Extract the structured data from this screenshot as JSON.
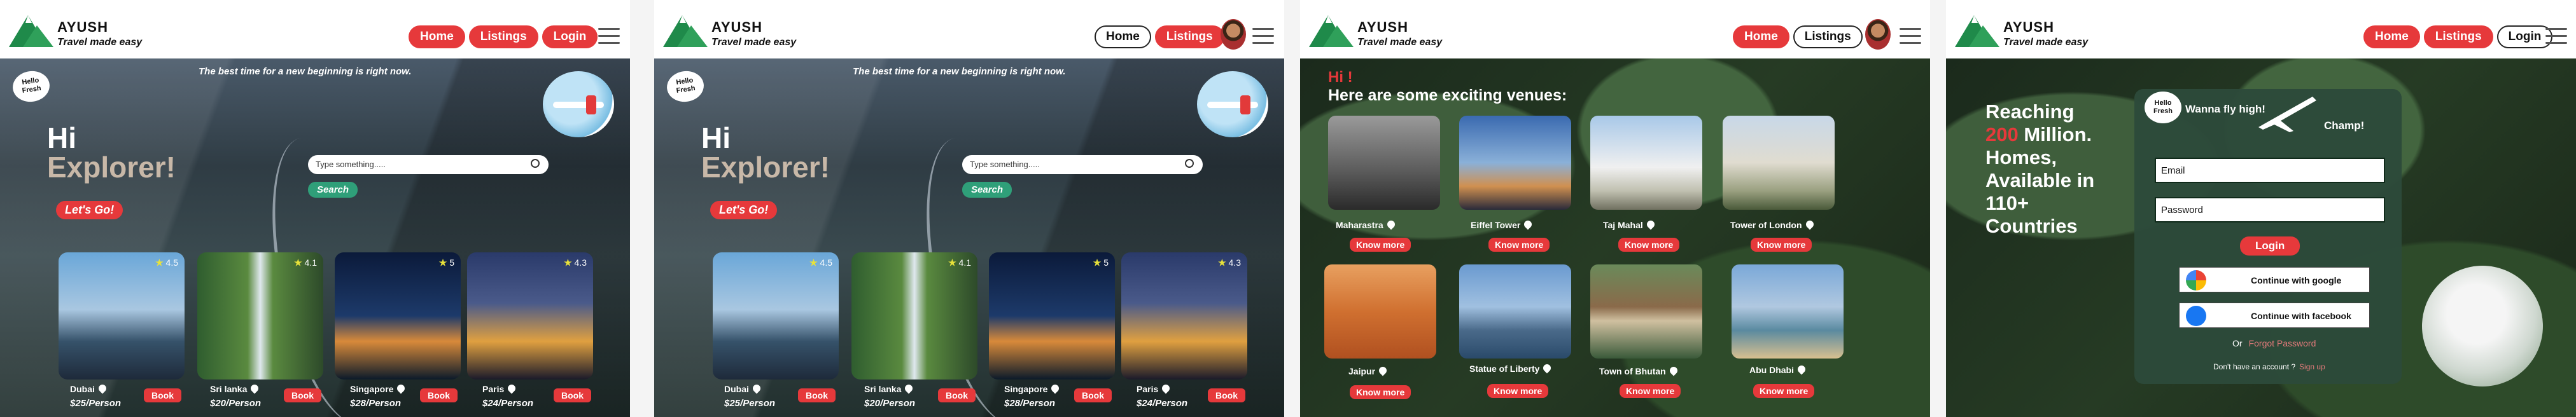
{
  "brand": {
    "name": "AYUSH",
    "tagline": "Travel made easy"
  },
  "nav": {
    "home": "Home",
    "listings": "Listings",
    "login": "Login"
  },
  "hero": {
    "badge": "Hello Fresh",
    "tagline": "The best time for a new beginning is right now.",
    "hi": "Hi",
    "explorer": "Explorer!",
    "lets_go": "Let's Go!",
    "search_placeholder": "Type something.....",
    "search_button": "Search"
  },
  "destinations": [
    {
      "name": "Dubai",
      "price": "$25/Person",
      "rating": "4.5",
      "book": "Book"
    },
    {
      "name": "Sri lanka",
      "price": "$20/Person",
      "rating": "4.1",
      "book": "Book"
    },
    {
      "name": "Singapore",
      "price": "$28/Person",
      "rating": "5",
      "book": "Book"
    },
    {
      "name": "Paris",
      "price": "$24/Person",
      "rating": "4.3",
      "book": "Book"
    }
  ],
  "venues": {
    "hi": "Hi !",
    "heading": "Here are some exciting venues:",
    "know_more": "Know more",
    "items": [
      {
        "name": "Maharastra"
      },
      {
        "name": "Eiffel Tower"
      },
      {
        "name": "Taj Mahal"
      },
      {
        "name": "Tower of London"
      },
      {
        "name": "Jaipur"
      },
      {
        "name": "Statue of Liberty"
      },
      {
        "name": "Town of Bhutan"
      },
      {
        "name": "Abu Dhabi"
      }
    ]
  },
  "login": {
    "reaching": "Reaching",
    "million_num": "200",
    "million_word": "Million.",
    "rest": "Homes, Available in 110+ Countries",
    "panel_title": "Wanna fly high!",
    "panel_champ": "Champ!",
    "email": "Email",
    "password": "Password",
    "button": "Login",
    "google": "Continue with google",
    "facebook": "Continue with facebook",
    "or": "Or",
    "forgot": "Forgot Password",
    "no_account": "Don't have an account ?",
    "signup": "Sign up"
  },
  "colors": {
    "accent": "#e6393b",
    "brand_green": "#1f8a4a",
    "search_green": "#2f9f79"
  }
}
